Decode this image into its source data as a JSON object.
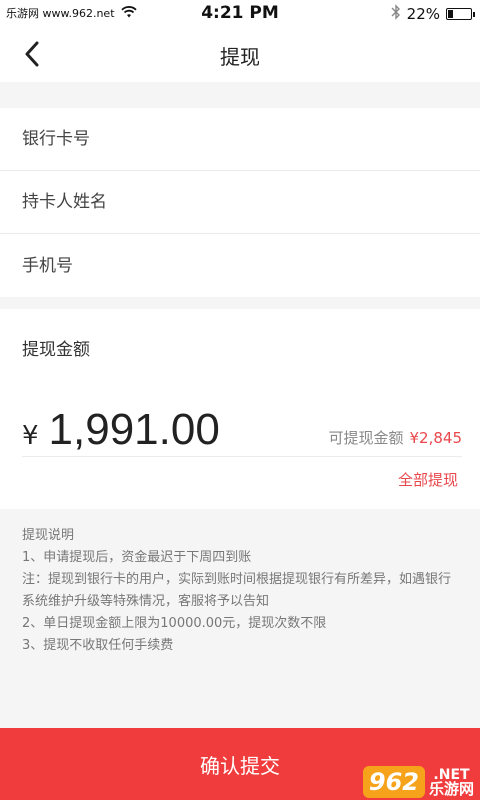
{
  "status_bar": {
    "carrier": "乐游网 www.962.net",
    "time": "4:21 PM",
    "battery_percent": "22%",
    "battery_level": 0.22
  },
  "nav": {
    "title": "提现"
  },
  "form": {
    "bank_card_placeholder": "银行卡号",
    "holder_name_placeholder": "持卡人姓名",
    "phone_placeholder": "手机号"
  },
  "amount": {
    "label": "提现金额",
    "currency": "¥",
    "value": "1,991.00",
    "available_label": "可提现金额",
    "available_value": "¥2,845",
    "withdraw_all": "全部提现"
  },
  "notes": {
    "title": "提现说明",
    "lines": [
      "1、申请提现后，资金最迟于下周四到账",
      "注：提现到银行卡的用户，实际到账时间根据提现银行有所差异，如遇银行系统维护升级等特殊情况，客服将予以告知",
      "2、单日提现金额上限为10000.00元，提现次数不限",
      "3、提现不收取任何手续费"
    ]
  },
  "submit_label": "确认提交",
  "watermark": {
    "logo": "962",
    "net": ".NET",
    "cn": "乐游网"
  },
  "colors": {
    "accent": "#f03c3c",
    "highlight": "#e8474c"
  }
}
